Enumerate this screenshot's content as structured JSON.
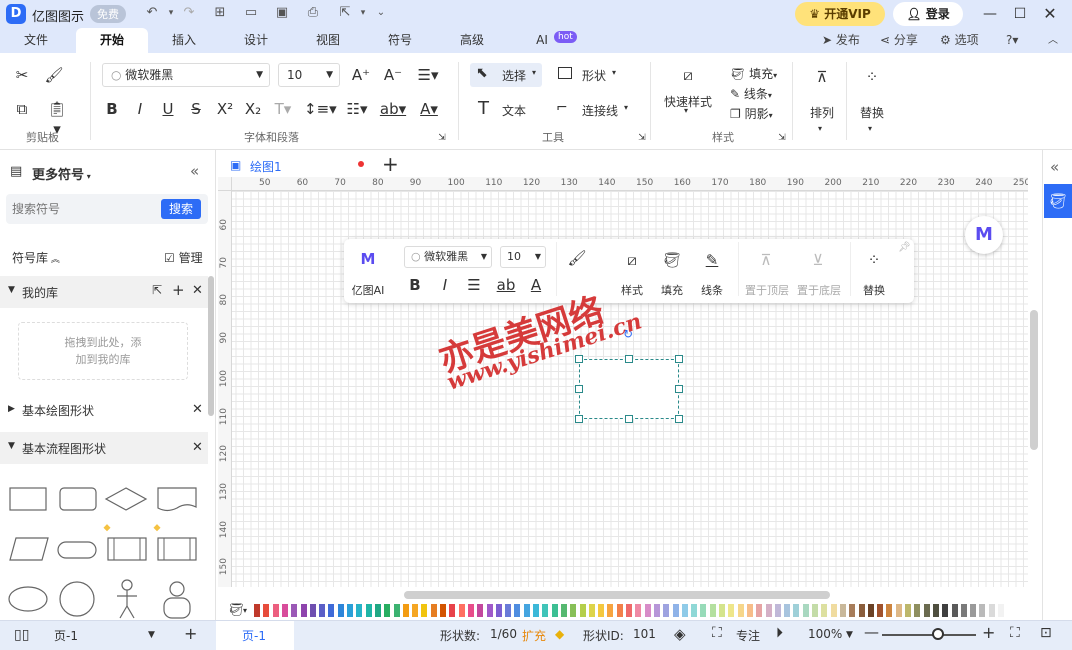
{
  "title_bar": {
    "app_name": "亿图图示",
    "free_badge": "免费",
    "vip_label": "开通VIP",
    "login_label": "登录"
  },
  "menu": {
    "tabs": [
      "文件",
      "开始",
      "插入",
      "设计",
      "视图",
      "符号",
      "高级",
      "AI"
    ],
    "active_tab": "开始",
    "ai_badge": "hot",
    "publish": "发布",
    "share": "分享",
    "options": "选项"
  },
  "ribbon": {
    "clipboard_label": "剪贴板",
    "font_name": "微软雅黑",
    "font_size": "10",
    "font_group_label": "字体和段落",
    "select_label": "选择",
    "shape_label": "形状",
    "text_label": "文本",
    "connector_label": "连接线",
    "tools_label": "工具",
    "quick_style_label": "快速样式",
    "fill_label": "填充",
    "line_label": "线条",
    "shadow_label": "阴影",
    "style_group_label": "样式",
    "arrange_label": "排列",
    "replace_label": "替换"
  },
  "sidebar": {
    "title": "更多符号",
    "search_placeholder": "搜索符号",
    "search_button": "搜索",
    "library_label": "符号库",
    "manage_label": "管理",
    "my_library": "我的库",
    "drop_hint_1": "拖拽到此处，添",
    "drop_hint_2": "加到我的库",
    "basic_shapes": "基本绘图形状",
    "flowchart_shapes": "基本流程图形状"
  },
  "document": {
    "tab_name": "绘图1"
  },
  "ruler": {
    "h_ticks": [
      "50",
      "60",
      "70",
      "80",
      "90",
      "100",
      "110",
      "120",
      "130",
      "140",
      "150",
      "160",
      "170",
      "180",
      "190",
      "200",
      "210",
      "220",
      "230",
      "240",
      "250"
    ],
    "v_ticks": [
      "60",
      "70",
      "80",
      "90",
      "100",
      "110",
      "120",
      "130",
      "140",
      "150"
    ]
  },
  "floating_toolbar": {
    "ai_label": "亿图AI",
    "font_name": "微软雅黑",
    "font_size": "10",
    "style_label": "样式",
    "fill_label": "填充",
    "line_label": "线条",
    "bring_front_label": "置于顶层",
    "send_back_label": "置于底层",
    "replace_label": "替换"
  },
  "watermark": {
    "line1": "亦是美网络",
    "line2": "www.yishimei.cn"
  },
  "palette": [
    "#c0392b",
    "#e74c3c",
    "#ec5f7f",
    "#d84d9b",
    "#9b59b6",
    "#8e44ad",
    "#6f4fb0",
    "#5b5fc7",
    "#3f6bd8",
    "#2d86d9",
    "#2aa0d8",
    "#27b3c8",
    "#1fb5a6",
    "#20a884",
    "#27ae60",
    "#3cb371",
    "#f39c12",
    "#f5a623",
    "#f1c40f",
    "#e67e22",
    "#d35400",
    "#e8434a",
    "#ff6f61",
    "#e84d8a",
    "#c3489d",
    "#a05ac9",
    "#7d5fd0",
    "#6a7bd8",
    "#4f8de0",
    "#45a5e0",
    "#3cb8d8",
    "#40c4b8",
    "#3cbf93",
    "#56b870",
    "#88c057",
    "#b5cf4b",
    "#ddd44a",
    "#f4c83f",
    "#f7a440",
    "#f2804a",
    "#ee6a6a",
    "#ef8aa5",
    "#d88cc8",
    "#b796d8",
    "#9ea3e0",
    "#8fb3e8",
    "#8fcbe8",
    "#8fd8d6",
    "#97dbb8",
    "#b4e09f",
    "#d4e48c",
    "#eee68a",
    "#f6d68a",
    "#f7bd8a",
    "#e6a4a4",
    "#d4b0c6",
    "#c0b8d8",
    "#a8c4de",
    "#9fd0d8",
    "#a9d8c0",
    "#c4dca8",
    "#dde0a0",
    "#f0dca0",
    "#c9b89a",
    "#a87d5a",
    "#8b5e3c",
    "#6b4226",
    "#a0522d",
    "#cd853f",
    "#deb887",
    "#bdb76b",
    "#8f8f5f",
    "#6b6b4f",
    "#4f4f3f",
    "#3f3f3f",
    "#5a5a5a",
    "#7a7a7a",
    "#9a9a9a",
    "#bababa",
    "#dadada",
    "#f2f2f2"
  ],
  "status": {
    "page_selector": "页-1",
    "page_tab": "页-1",
    "shape_count_label": "形状数:",
    "shape_count": "1/60",
    "expand_label": "扩充",
    "shape_id_label": "形状ID:",
    "shape_id": "101",
    "focus_label": "专注",
    "zoom": "100%",
    "zoom_level": 0.6
  },
  "colors": {
    "accent": "#2d6cf6",
    "selection": "#2a8a8a",
    "watermark": "#d32b2b"
  }
}
